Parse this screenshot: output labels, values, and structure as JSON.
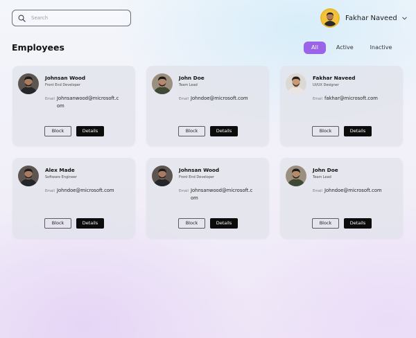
{
  "search": {
    "placeholder": "Search",
    "value": ""
  },
  "user": {
    "name": "Fakhar Naveed"
  },
  "page": {
    "title": "Employees"
  },
  "filters": [
    {
      "label": "All",
      "active": true
    },
    {
      "label": "Active",
      "active": false
    },
    {
      "label": "Inactive",
      "active": false
    }
  ],
  "employees": [
    {
      "name": "Johnsan Wood",
      "role": "Front End Developer",
      "email_label": "Email",
      "email": "Johnsanwood@microsoft.com",
      "avatar": "dark-jacket",
      "block_label": "Block",
      "details_label": "Details"
    },
    {
      "name": "John Doe",
      "role": "Team Lead",
      "email_label": "Email",
      "email": "Johndoe@microsoft.com",
      "avatar": "green-jacket",
      "block_label": "Block",
      "details_label": "Details"
    },
    {
      "name": "Fakhar Naveed",
      "role": "UI/UX Designer",
      "email_label": "Email",
      "email": "fakhar@microsoft.com",
      "avatar": "light",
      "block_label": "Block",
      "details_label": "Details"
    },
    {
      "name": "Alex Made",
      "role": "Software Engineer",
      "email_label": "Email",
      "email": "Johndoe@microsoft.com",
      "avatar": "dark-jacket",
      "block_label": "Block",
      "details_label": "Details"
    },
    {
      "name": "Johnsan Wood",
      "role": "Front End Developer",
      "email_label": "Email",
      "email": "Johnsanwood@microsoft.com",
      "avatar": "dark-jacket",
      "block_label": "Block",
      "details_label": "Details"
    },
    {
      "name": "John Doe",
      "role": "Team Lead",
      "email_label": "Email",
      "email": "Johndoe@microsoft.com",
      "avatar": "green-jacket",
      "block_label": "Block",
      "details_label": "Details"
    }
  ],
  "colors": {
    "accent": "#9a63e8",
    "details_button": "#0c0c0c",
    "card_background": "#e1e3eb",
    "user_avatar_ring": "#e8b92a"
  },
  "icons": {
    "search": "search-icon",
    "user_menu": "chevron-down-icon"
  }
}
